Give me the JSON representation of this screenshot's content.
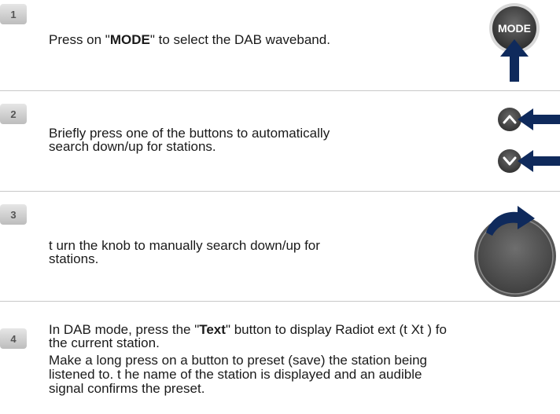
{
  "steps": [
    {
      "number": "1",
      "text_before": "Press on \"",
      "text_bold": "MODE",
      "text_after": "\" to select the DAB waveband.",
      "button_label": "MODE",
      "icon": "mode-button-with-arrow"
    },
    {
      "number": "2",
      "line1": "Briefly press one of the buttons to automatically",
      "line2": "search down/up for stations.",
      "icon": "up-down-buttons-with-arrows"
    },
    {
      "number": "3",
      "line1": "t urn the knob to manually search down/up for",
      "line2": "stations.",
      "icon": "rotary-knob-with-arrow"
    },
    {
      "number": "4",
      "line1_before": "In DAB mode, press the \"",
      "line1_bold": "Text",
      "line1_after": "\" button to display Radiot ext (t Xt ) fo",
      "line2": "the current station.",
      "para2_line1": "Make a long press on a button to preset (save) the station being",
      "para2_line2": "listened to. t he name of the station is displayed and an audible",
      "para2_line3": "signal confirms the preset."
    }
  ],
  "colors": {
    "arrow_navy": "#0f2a5c",
    "button_dark": "#4a4a4a",
    "badge_text": "#555555",
    "divider": "#c8c8c8"
  }
}
